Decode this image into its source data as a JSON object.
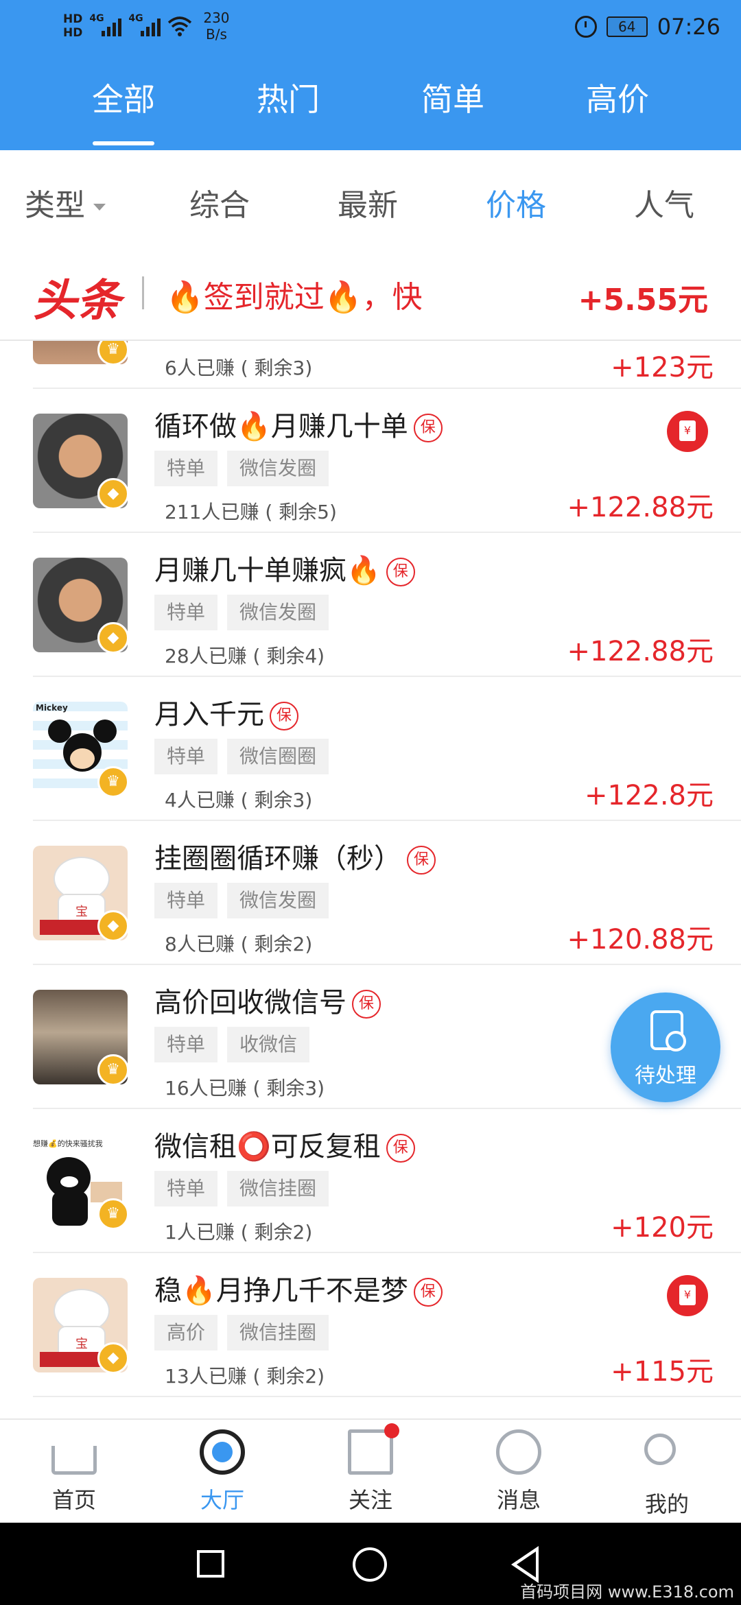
{
  "status_bar": {
    "hd1": "HD",
    "hd2": "HD",
    "net1": "4G",
    "net2": "4G",
    "speed_value": "230",
    "speed_unit": "B/s",
    "battery": "64",
    "time": "07:26"
  },
  "top_tabs": [
    {
      "label": "全部",
      "active": true
    },
    {
      "label": "热门",
      "active": false
    },
    {
      "label": "简单",
      "active": false
    },
    {
      "label": "高价",
      "active": false
    }
  ],
  "filters": {
    "type_label": "类型",
    "sort": [
      "综合",
      "最新",
      "价格",
      "人气"
    ],
    "active_sort": "价格"
  },
  "banner": {
    "brand": "头条",
    "text": "🔥签到就过🔥，快",
    "amount": "+5.55元"
  },
  "tasks": [
    {
      "title": "",
      "earned": "6人已赚 ( 剩余3)",
      "price": "+123元",
      "badge": "crown"
    },
    {
      "title": "循环做🔥月赚几十单",
      "tags": [
        "特单",
        "微信发圈"
      ],
      "earned": "211人已赚 ( 剩余5)",
      "price": "+122.88元",
      "badge": "diamond",
      "red_icon": true
    },
    {
      "title": "月赚几十单赚疯🔥",
      "tags": [
        "特单",
        "微信发圈"
      ],
      "earned": "28人已赚 ( 剩余4)",
      "price": "+122.88元",
      "badge": "diamond"
    },
    {
      "title": "月入千元",
      "tags": [
        "特单",
        "微信圈圈"
      ],
      "earned": "4人已赚 ( 剩余3)",
      "price": "+122.8元",
      "badge": "crown"
    },
    {
      "title": "挂圈圈循环赚（秒）",
      "tags": [
        "特单",
        "微信发圈"
      ],
      "earned": "8人已赚 ( 剩余2)",
      "price": "+120.88元",
      "badge": "diamond"
    },
    {
      "title": "高价回收微信号",
      "tags": [
        "特单",
        "收微信"
      ],
      "earned": "16人已赚 ( 剩余3)",
      "price": "",
      "badge": "crown"
    },
    {
      "title": "微信租⭕可反复租",
      "tags": [
        "特单",
        "微信挂圈"
      ],
      "earned": "1人已赚 ( 剩余2)",
      "price": "+120元",
      "badge": "crown"
    },
    {
      "title": "稳🔥月挣几千不是梦",
      "tags": [
        "高价",
        "微信挂圈"
      ],
      "earned": "13人已赚 ( 剩余2)",
      "price": "+115元",
      "badge": "diamond",
      "red_icon": true
    }
  ],
  "bao_label": "保",
  "avatar_text": {
    "mickey": "Mickey",
    "lucky_cat": "宝",
    "kumamon": "想赚💰的快来骚扰我"
  },
  "fab": {
    "label": "待处理"
  },
  "bottom_nav": [
    {
      "label": "首页",
      "icon": "home-icon",
      "active": false
    },
    {
      "label": "大厅",
      "icon": "hall-icon",
      "active": true
    },
    {
      "label": "关注",
      "icon": "follow-icon",
      "active": false
    },
    {
      "label": "消息",
      "icon": "message-icon",
      "active": false
    },
    {
      "label": "我的",
      "icon": "profile-icon",
      "active": false
    }
  ],
  "watermark": "首码项目网 www.E318.com",
  "colors": {
    "primary": "#3a97f0",
    "price_red": "#e5262b",
    "badge_gold": "#f3b323"
  }
}
